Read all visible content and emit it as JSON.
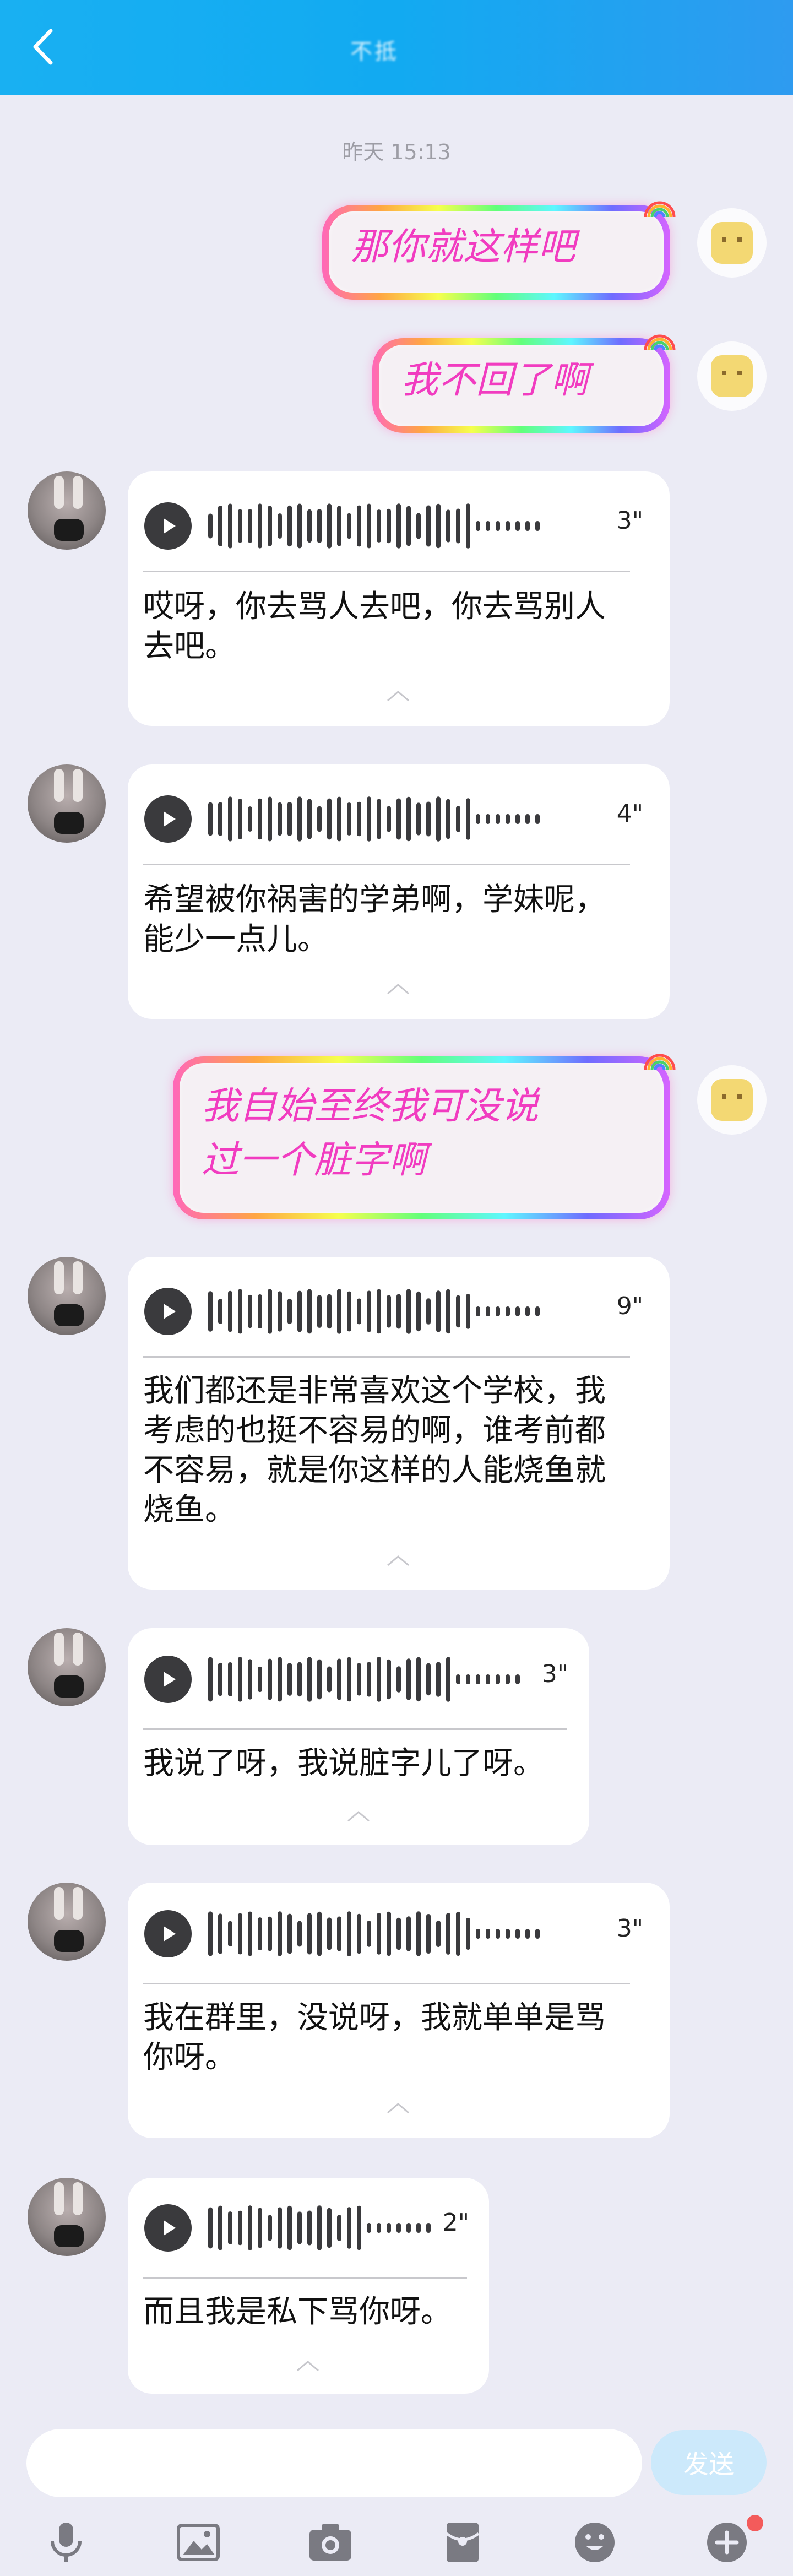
{
  "header": {
    "title": "不抵"
  },
  "timestamp": "昨天 15:13",
  "outgoing": [
    {
      "text": "那你就这样吧"
    },
    {
      "text": "我不回了啊"
    },
    {
      "line1": "我自始至终我可没说",
      "line2": "过一个脏字啊"
    }
  ],
  "incoming": [
    {
      "duration": "3\"",
      "line1": "哎呀，你去骂人去吧，你去骂别人",
      "line2": "去吧。"
    },
    {
      "duration": "4\"",
      "line1": "希望被你祸害的学弟啊，学妹呢，",
      "line2": "能少一点儿。"
    },
    {
      "duration": "9\"",
      "line1": "我们都还是非常喜欢这个学校，我",
      "line2": "考虑的也挺不容易的啊，谁考前都",
      "line3": "不容易，就是你这样的人能烧鱼就",
      "line4": "烧鱼。"
    },
    {
      "duration": "3\"",
      "line1": "我说了呀，我说脏字儿了呀。"
    },
    {
      "duration": "3\"",
      "line1": "我在群里，没说呀，我就单单是骂",
      "line2": "你呀。"
    },
    {
      "duration": "2\"",
      "line1": "而且我是私下骂你呀。"
    }
  ],
  "input": {
    "send_label": "发送"
  },
  "toolbar_icons": [
    "mic-icon",
    "image-icon",
    "camera-icon",
    "red-packet-icon",
    "emoji-icon",
    "plus-icon"
  ],
  "colors": {
    "header": "#19b0f2",
    "background": "#ebebf5",
    "sticker_text": "#f13cc0",
    "send": "#cce9fb"
  }
}
